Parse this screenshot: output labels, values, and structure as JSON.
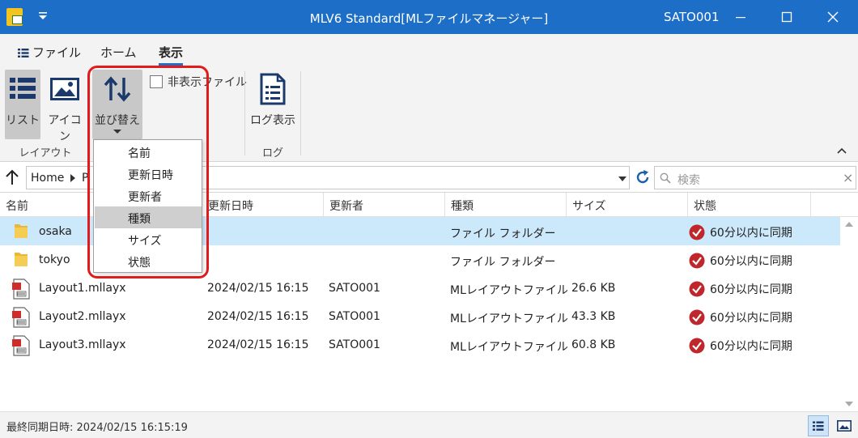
{
  "window": {
    "title": "MLV6 Standard[MLファイルマネージャー]",
    "user": "SATO001"
  },
  "tabs": [
    {
      "label": "ファイル"
    },
    {
      "label": "ホーム"
    },
    {
      "label": "表示"
    }
  ],
  "ribbon": {
    "list_label": "リスト",
    "icon_label": "アイコン",
    "sort_label": "並び替え",
    "hidden_files_label": "非表示ファイル",
    "hidden_files_checked": false,
    "log_label": "ログ表示",
    "group_layout": "レイアウト",
    "group_log": "ログ"
  },
  "sort_menu": [
    {
      "label": "名前"
    },
    {
      "label": "更新日時"
    },
    {
      "label": "更新者"
    },
    {
      "label": "種類"
    },
    {
      "label": "サイズ"
    },
    {
      "label": "状態"
    }
  ],
  "address": {
    "root": "Home",
    "next_partial": "P",
    "search_placeholder": "検索"
  },
  "columns": [
    {
      "label": "名前"
    },
    {
      "label": "更新日時"
    },
    {
      "label": "更新者"
    },
    {
      "label": "種類"
    },
    {
      "label": "サイズ"
    },
    {
      "label": "状態"
    }
  ],
  "rows": [
    {
      "name": "osaka",
      "modified": "",
      "modified_by": "",
      "type": "ファイル フォルダー",
      "size": "",
      "status": "60分以内に同期",
      "kind": "folder",
      "selected": true
    },
    {
      "name": "tokyo",
      "modified": "",
      "modified_by": "",
      "type": "ファイル フォルダー",
      "size": "",
      "status": "60分以内に同期",
      "kind": "folder",
      "selected": false
    },
    {
      "name": "Layout1.mllayx",
      "modified": "2024/02/15 16:15",
      "modified_by": "SATO001",
      "type": "MLレイアウトファイル",
      "size": "26.6 KB",
      "status": "60分以内に同期",
      "kind": "layout-file",
      "selected": false
    },
    {
      "name": "Layout2.mllayx",
      "modified": "2024/02/15 16:15",
      "modified_by": "SATO001",
      "type": "MLレイアウトファイル",
      "size": "43.3 KB",
      "status": "60分以内に同期",
      "kind": "layout-file",
      "selected": false
    },
    {
      "name": "Layout3.mllayx",
      "modified": "2024/02/15 16:15",
      "modified_by": "SATO001",
      "type": "MLレイアウトファイル",
      "size": "60.8 KB",
      "status": "60分以内に同期",
      "kind": "layout-file",
      "selected": false
    }
  ],
  "statusbar": {
    "text": "最終同期日時: 2024/02/15 16:15:19"
  },
  "colors": {
    "title_bar": "#1d6ec6",
    "selected_row": "#cce8fb",
    "highlight_box": "#e11b1b",
    "sync_status": "#c0272d"
  },
  "icons": {
    "app": "app-logo-icon",
    "list_view": "list-view-icon",
    "icon_view": "image-icon",
    "sort": "sort-arrows-icon",
    "log": "document-icon",
    "up": "arrow-up-icon",
    "refresh": "refresh-icon",
    "search": "search-icon",
    "folder": "folder-icon",
    "file": "layout-file-icon",
    "status": "check-circle-icon"
  }
}
